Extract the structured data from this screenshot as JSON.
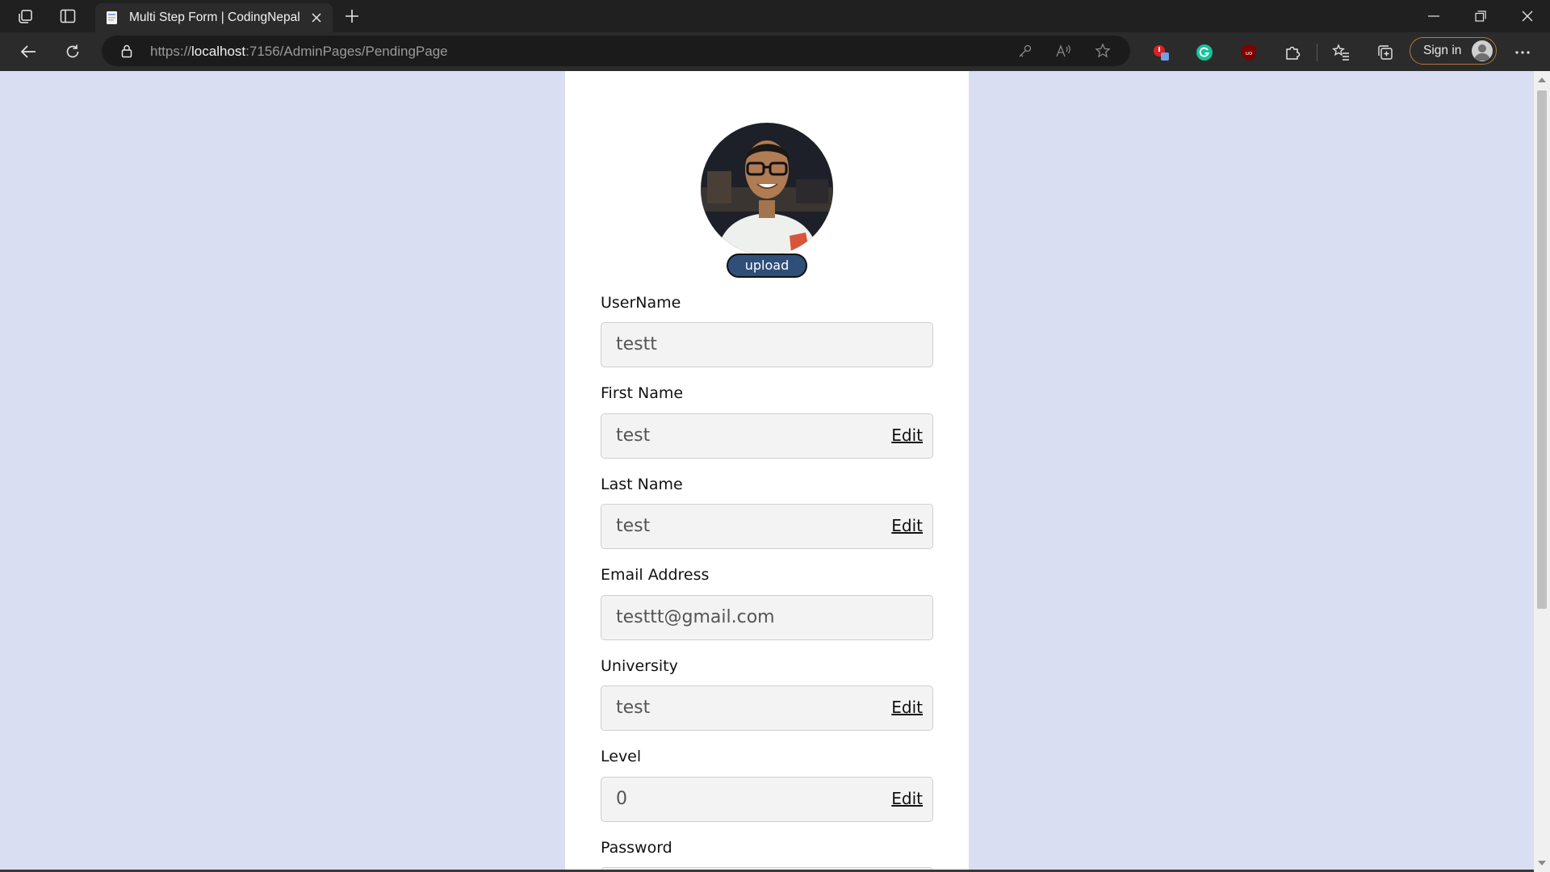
{
  "browser": {
    "tab_title": "Multi Step Form | CodingNepal",
    "url_prefix": "https://",
    "url_host": "localhost",
    "url_path": ":7156/AdminPages/PendingPage",
    "signin_label": "Sign in"
  },
  "form": {
    "upload_label": "upload",
    "edit_label": "Edit",
    "fields": [
      {
        "label": "UserName",
        "value": "testt"
      },
      {
        "label": "First Name",
        "value": "test"
      },
      {
        "label": "Last Name",
        "value": "test"
      },
      {
        "label": "Email Address",
        "value": "testtt@gmail.com"
      },
      {
        "label": "University",
        "value": "test"
      },
      {
        "label": "Level",
        "value": "0"
      },
      {
        "label": "Password",
        "value": ""
      }
    ]
  },
  "colors": {
    "page_background": "#d9def3",
    "upload_button": "#2f4f79",
    "browser_frame": "#202020"
  }
}
